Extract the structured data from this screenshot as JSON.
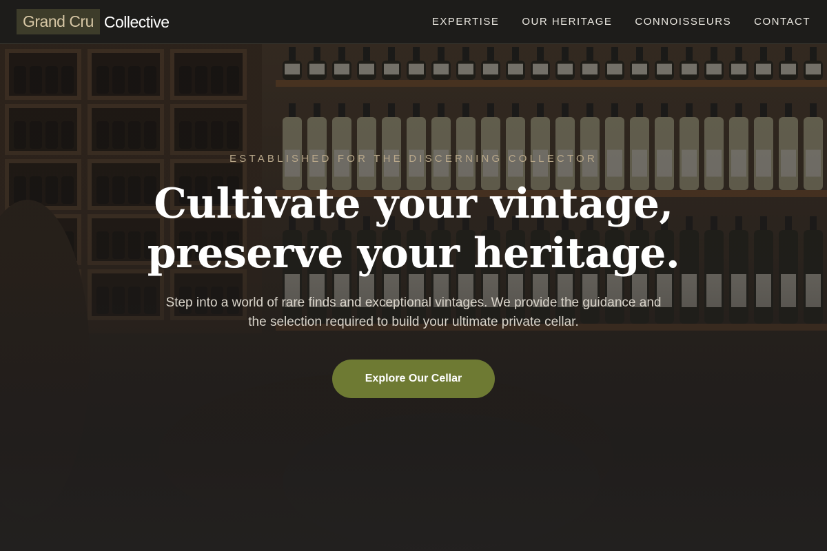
{
  "header": {
    "logo_mark": "Grand Cru",
    "logo_text": "Collective",
    "nav": [
      {
        "label": "EXPERTISE"
      },
      {
        "label": "OUR HERITAGE"
      },
      {
        "label": "CONNOISSEURS"
      },
      {
        "label": "CONTACT"
      }
    ]
  },
  "hero": {
    "eyebrow": "ESTABLISHED FOR THE DISCERNING COLLECTOR",
    "headline_line1": "Cultivate your vintage,",
    "headline_line2": "preserve your heritage.",
    "subtext_line1": "Step into a world of rare finds and exceptional vintages. We provide the guidance and",
    "subtext_line2": "the selection required to build your ultimate private cellar.",
    "cta_label": "Explore Our Cellar"
  },
  "colors": {
    "header_bg": "#1d1c1a",
    "logo_mark_bg": "#3d3c2a",
    "logo_mark_text": "#d6c6a4",
    "eyebrow": "#b9a88a",
    "cta_bg": "#6e7a33"
  }
}
